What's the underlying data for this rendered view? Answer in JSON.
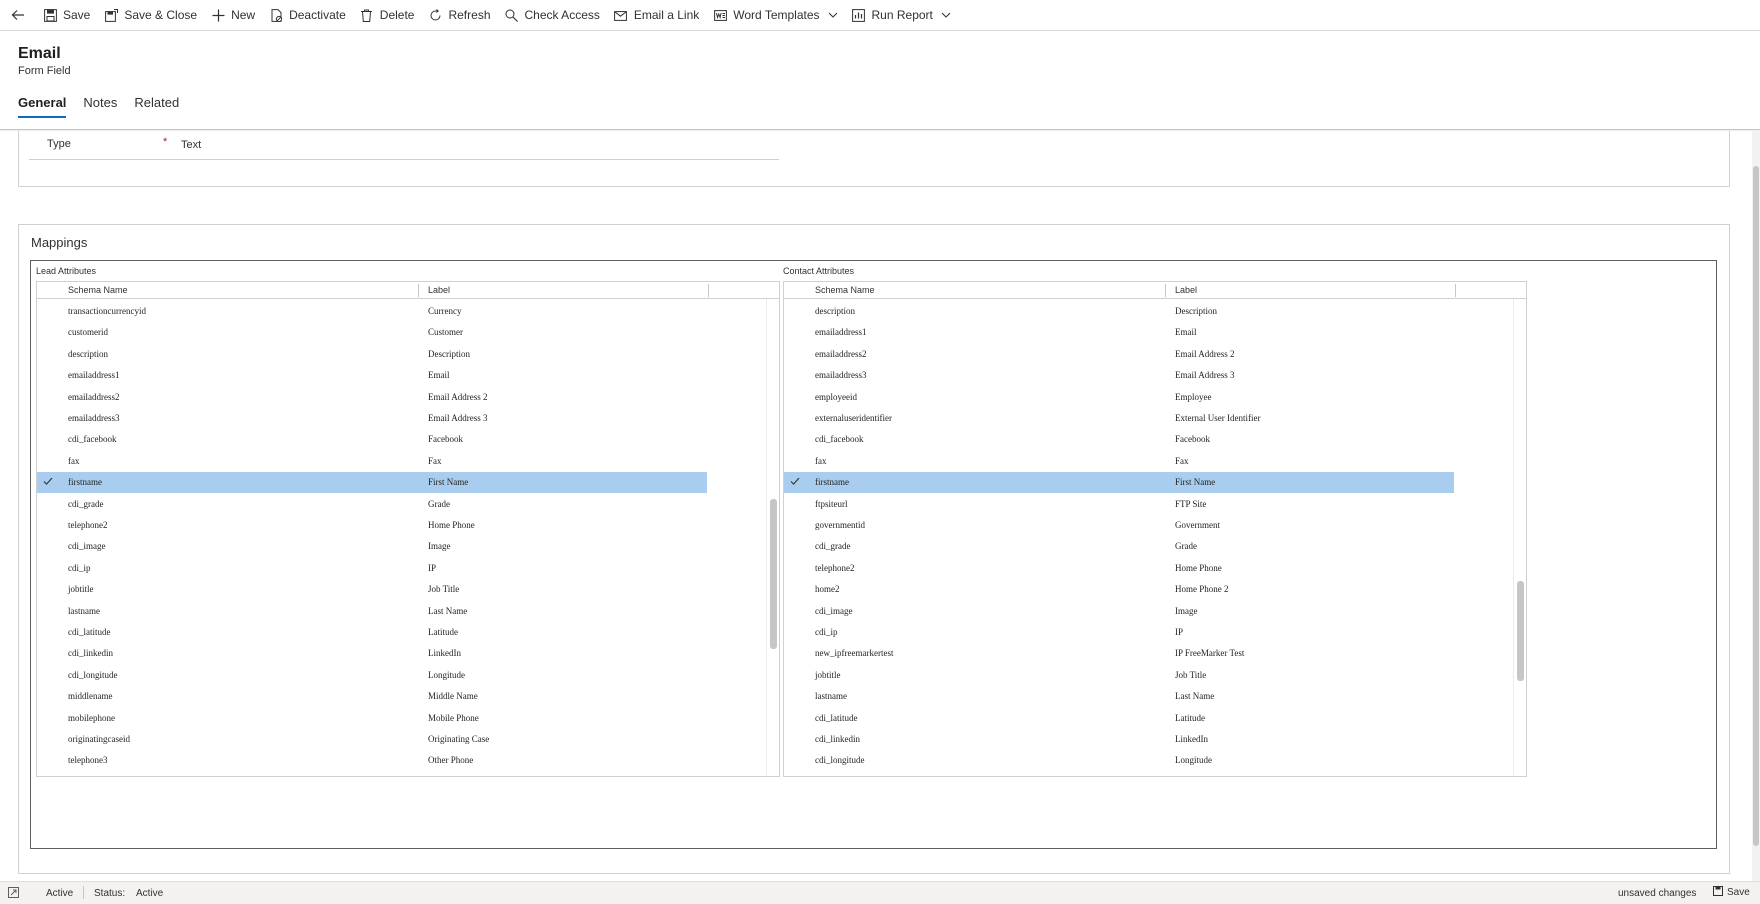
{
  "toolbar": {
    "back_icon": "arrow-left-icon",
    "save": "Save",
    "save_close": "Save & Close",
    "new": "New",
    "deactivate": "Deactivate",
    "delete": "Delete",
    "refresh": "Refresh",
    "check_access": "Check Access",
    "email_link": "Email a Link",
    "word_templates": "Word Templates",
    "run_report": "Run Report"
  },
  "header": {
    "title": "Email",
    "subtitle": "Form Field",
    "tabs": [
      {
        "label": "General",
        "active": true
      },
      {
        "label": "Notes",
        "active": false
      },
      {
        "label": "Related",
        "active": false
      }
    ]
  },
  "type_field": {
    "label": "Type",
    "required_mark": "*",
    "value": "Text"
  },
  "mappings": {
    "title": "Mappings",
    "lead": {
      "caption": "Lead Attributes",
      "col_schema": "Schema Name",
      "col_label": "Label",
      "rows": [
        {
          "schema": "transactioncurrencyid",
          "label": "Currency"
        },
        {
          "schema": "customerid",
          "label": "Customer"
        },
        {
          "schema": "description",
          "label": "Description"
        },
        {
          "schema": "emailaddress1",
          "label": "Email"
        },
        {
          "schema": "emailaddress2",
          "label": "Email Address 2"
        },
        {
          "schema": "emailaddress3",
          "label": "Email Address 3"
        },
        {
          "schema": "cdi_facebook",
          "label": "Facebook"
        },
        {
          "schema": "fax",
          "label": "Fax"
        },
        {
          "schema": "firstname",
          "label": "First Name",
          "selected": true
        },
        {
          "schema": "cdi_grade",
          "label": "Grade"
        },
        {
          "schema": "telephone2",
          "label": "Home Phone"
        },
        {
          "schema": "cdi_image",
          "label": "Image"
        },
        {
          "schema": "cdi_ip",
          "label": "IP"
        },
        {
          "schema": "jobtitle",
          "label": "Job Title"
        },
        {
          "schema": "lastname",
          "label": "Last Name"
        },
        {
          "schema": "cdi_latitude",
          "label": "Latitude"
        },
        {
          "schema": "cdi_linkedin",
          "label": "LinkedIn"
        },
        {
          "schema": "cdi_longitude",
          "label": "Longitude"
        },
        {
          "schema": "middlename",
          "label": "Middle Name"
        },
        {
          "schema": "mobilephone",
          "label": "Mobile Phone"
        },
        {
          "schema": "originatingcaseid",
          "label": "Originating Case"
        },
        {
          "schema": "telephone3",
          "label": "Other Phone"
        }
      ]
    },
    "contact": {
      "caption": "Contact Attributes",
      "col_schema": "Schema Name",
      "col_label": "Label",
      "rows": [
        {
          "schema": "description",
          "label": "Description"
        },
        {
          "schema": "emailaddress1",
          "label": "Email"
        },
        {
          "schema": "emailaddress2",
          "label": "Email Address 2"
        },
        {
          "schema": "emailaddress3",
          "label": "Email Address 3"
        },
        {
          "schema": "employeeid",
          "label": "Employee"
        },
        {
          "schema": "externaluseridentifier",
          "label": "External User Identifier"
        },
        {
          "schema": "cdi_facebook",
          "label": "Facebook"
        },
        {
          "schema": "fax",
          "label": "Fax"
        },
        {
          "schema": "firstname",
          "label": "First Name",
          "selected": true
        },
        {
          "schema": "ftpsiteurl",
          "label": "FTP Site"
        },
        {
          "schema": "governmentid",
          "label": "Government"
        },
        {
          "schema": "cdi_grade",
          "label": "Grade"
        },
        {
          "schema": "telephone2",
          "label": "Home Phone"
        },
        {
          "schema": "home2",
          "label": "Home Phone 2"
        },
        {
          "schema": "cdi_image",
          "label": "Image"
        },
        {
          "schema": "cdi_ip",
          "label": "IP"
        },
        {
          "schema": "new_ipfreemarkertest",
          "label": "IP FreeMarker Test"
        },
        {
          "schema": "jobtitle",
          "label": "Job Title"
        },
        {
          "schema": "lastname",
          "label": "Last Name"
        },
        {
          "schema": "cdi_latitude",
          "label": "Latitude"
        },
        {
          "schema": "cdi_linkedin",
          "label": "LinkedIn"
        },
        {
          "schema": "cdi_longitude",
          "label": "Longitude"
        }
      ]
    }
  },
  "status_bar": {
    "state": "Active",
    "status_label": "Status:",
    "status_value": "Active",
    "unsaved": "unsaved changes",
    "save": "Save"
  },
  "colors": {
    "selected_row": "#a9cdee",
    "accent": "#0f6cbd",
    "required": "#a4262c"
  }
}
